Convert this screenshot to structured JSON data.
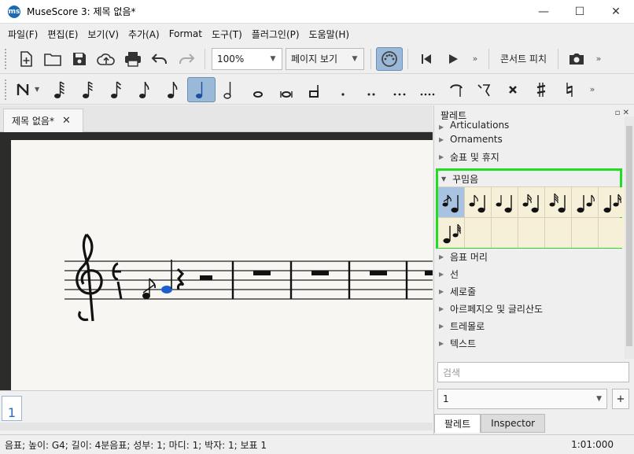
{
  "window": {
    "title": "MuseScore 3: 제목 없음*",
    "app_icon": "ms",
    "minimize": "—",
    "maximize": "☐",
    "close": "✕"
  },
  "menu": [
    "파일(F)",
    "편집(E)",
    "보기(V)",
    "추가(A)",
    "Format",
    "도구(T)",
    "플러그인(P)",
    "도움말(H)"
  ],
  "toolbar": {
    "zoom": "100%",
    "view_mode": "페이지 보기",
    "more": "»",
    "concert_pitch": "콘서트 피치"
  },
  "note_input": {
    "more": "»"
  },
  "score_tab": {
    "label": "제목 없음*",
    "close": "✕"
  },
  "navigator": {
    "page_number": "1"
  },
  "palette": {
    "title": "팔레트",
    "header_icons": "▫ ✕",
    "items_top": [
      "Articulations",
      "Ornaments",
      "숨표 및 휴지"
    ],
    "open_section": "꾸밈음",
    "items_bottom": [
      "음표 머리",
      "선",
      "세로줄",
      "아르페지오 및 글리산도",
      "트레몰로",
      "텍스트"
    ],
    "search_placeholder": "검색",
    "workspace": "1",
    "add": "+",
    "tabs": [
      "팔레트",
      "Inspector"
    ]
  },
  "status": {
    "text": "음표; 높이: G4; 길이: 4분음표; 성부: 1;  마디: 1; 박자: 1; 보표 1",
    "time": "1:01:000"
  },
  "colors": {
    "highlight": "#22dd22",
    "selected_note": "#1e5fd0",
    "accent": "#9ab9d8"
  }
}
